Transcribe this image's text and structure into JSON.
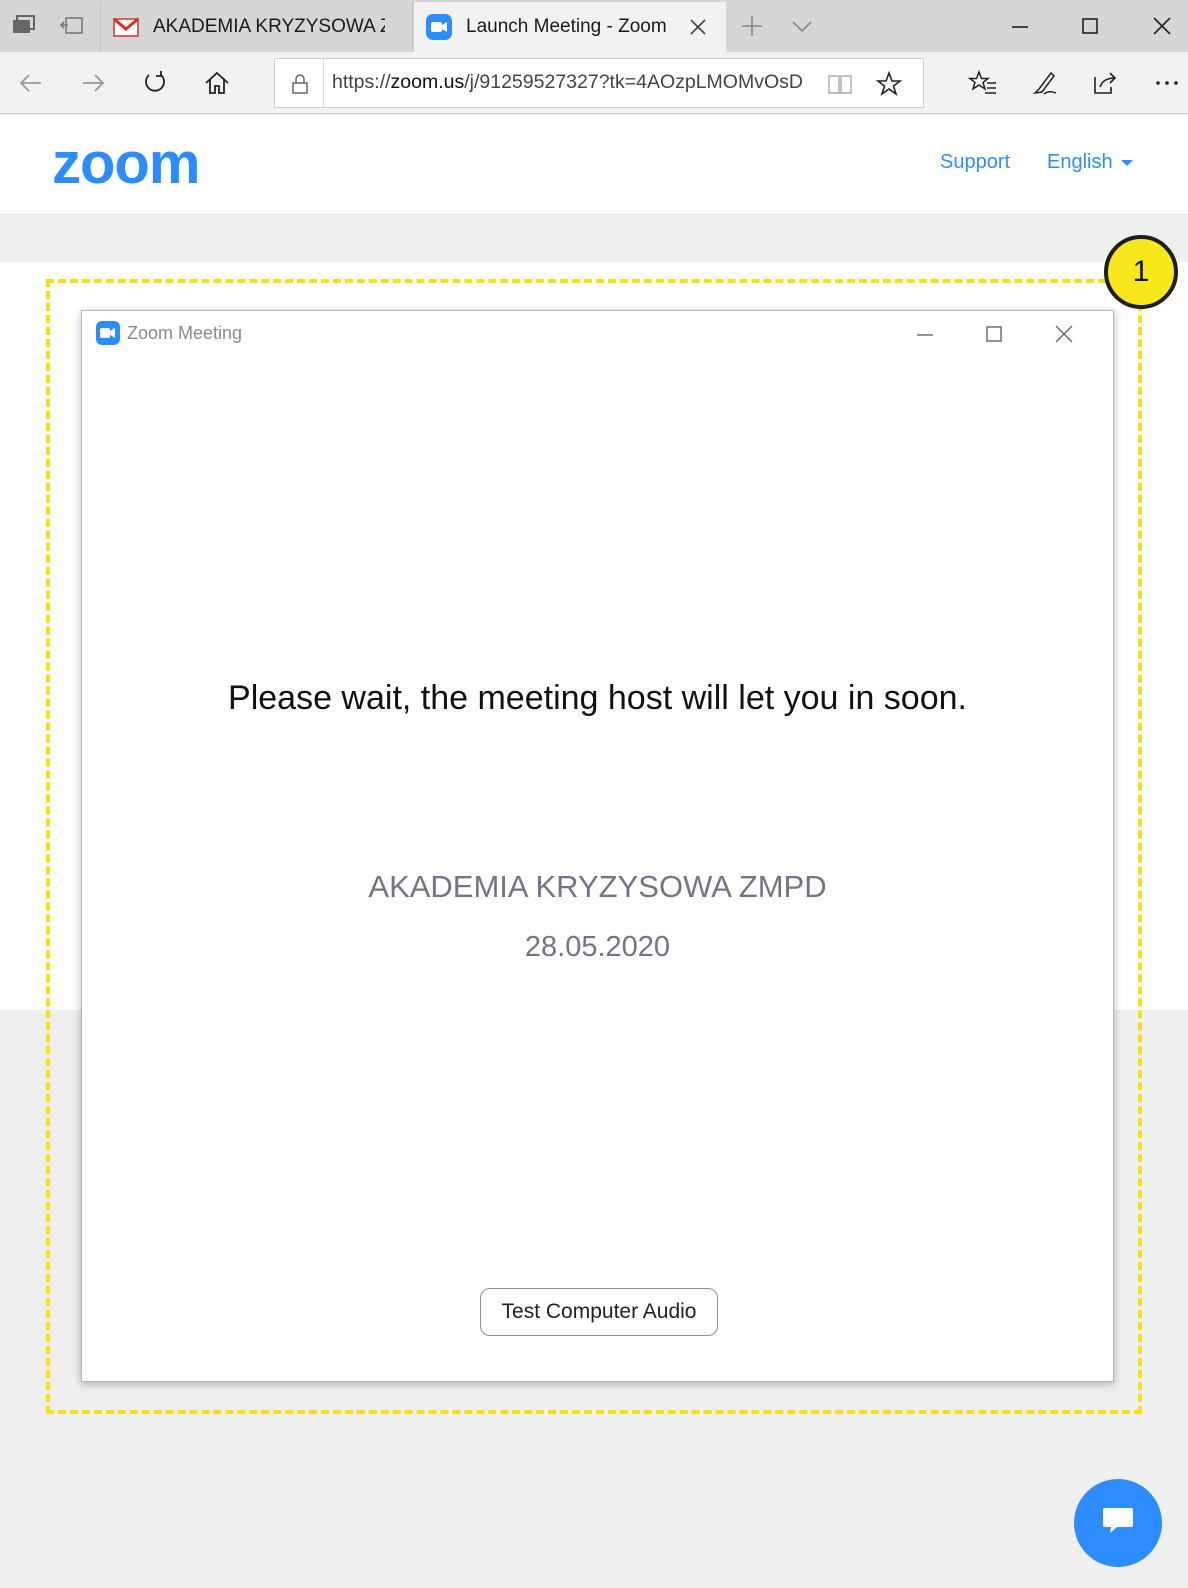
{
  "browser": {
    "tabs": [
      {
        "label": "AKADEMIA KRYZYSOWA ZMPD",
        "favicon": "gmail-icon",
        "active": false
      },
      {
        "label": "Launch Meeting - Zoom",
        "favicon": "zoom-icon",
        "active": true
      }
    ],
    "url_prefix": "https://",
    "url_host": "zoom.us",
    "url_rest": "/j/91259527327?tk=4AOzpLMOMvOsD",
    "accent": "#0078d7"
  },
  "zoom_header": {
    "logo_text": "zoom",
    "support_label": "Support",
    "language_label": "English",
    "brand_color": "#2d8cff"
  },
  "dialog": {
    "title": "Zoom Meeting",
    "wait_message": "Please wait, the meeting host will let you in soon.",
    "meeting_name": "AKADEMIA KRYZYSOWA ZMPD",
    "meeting_date": "28.05.2020",
    "test_audio_label": "Test Computer Audio"
  },
  "annotation": {
    "badge_number": "1",
    "highlight_color": "#f6e012"
  }
}
